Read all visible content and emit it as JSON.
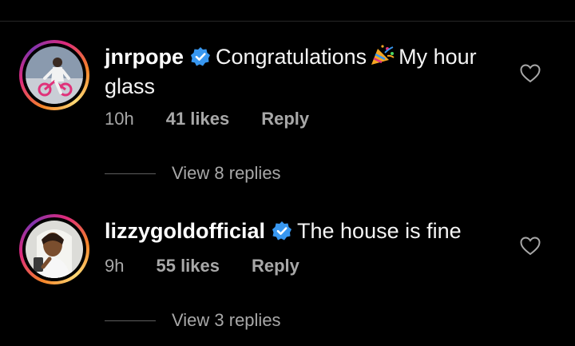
{
  "comments": [
    {
      "username": "jnrpope",
      "text_before_emoji": "Congratulations",
      "emoji": "party-popper",
      "text_after_emoji": "My hour glass",
      "time": "10h",
      "likes": "41 likes",
      "reply_label": "Reply",
      "view_replies": "View 8 replies",
      "avatar_icon": "user-on-bike-avatar"
    },
    {
      "username": "lizzygoldofficial",
      "text": "The house is fine",
      "time": "9h",
      "likes": "55 likes",
      "reply_label": "Reply",
      "view_replies": "View 3 replies",
      "avatar_icon": "user-selfie-avatar"
    }
  ],
  "colors": {
    "background": "#000000",
    "text": "#f5f5f5",
    "muted": "#a8a8a8",
    "verified": "#3897f0"
  }
}
